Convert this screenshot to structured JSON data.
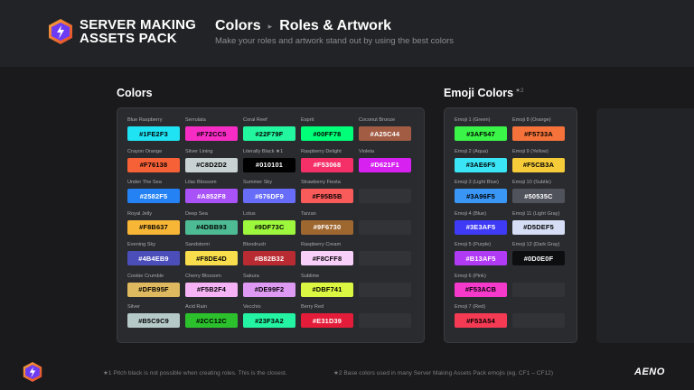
{
  "header": {
    "brand_line1": "SERVER MAKING",
    "brand_line2": "ASSETS PACK",
    "crumb_current_section": "Colors",
    "crumb_separator": "▸",
    "crumb_page": "Roles & Artwork",
    "subtitle": "Make your roles and artwork stand out by using the best colors"
  },
  "colors_section": {
    "title": "Colors",
    "swatches": [
      {
        "name": "Blue Raspberry",
        "hex": "#1FE2F3",
        "text": "#000"
      },
      {
        "name": "Serrulata",
        "hex": "#F72CC5",
        "text": "#000"
      },
      {
        "name": "Coral Reef",
        "hex": "#22F79F",
        "text": "#000"
      },
      {
        "name": "Esprit",
        "hex": "#00FF78",
        "text": "#000"
      },
      {
        "name": "Coconut Bronze",
        "hex": "#A25C44",
        "text": "#fff"
      },
      {
        "name": "Crayon Orange",
        "hex": "#F76138",
        "text": "#000"
      },
      {
        "name": "Silver Lining",
        "hex": "#C8D2D2",
        "text": "#000"
      },
      {
        "name": "Literally Black ★1",
        "hex": "#010101",
        "text": "#fff"
      },
      {
        "name": "Raspberry Delight",
        "hex": "#F53068",
        "text": "#fff"
      },
      {
        "name": "Violeta",
        "hex": "#D621F1",
        "text": "#fff"
      },
      {
        "name": "Under The Sea",
        "hex": "#2582F5",
        "text": "#fff"
      },
      {
        "name": "Lilac Blossom",
        "hex": "#A852F8",
        "text": "#fff"
      },
      {
        "name": "Summer Sky",
        "hex": "#676DF9",
        "text": "#fff"
      },
      {
        "name": "Strawberry Fiesta",
        "hex": "#F95B5B",
        "text": "#000"
      },
      null,
      {
        "name": "Royal Jelly",
        "hex": "#F8B637",
        "text": "#000"
      },
      {
        "name": "Deep Sea",
        "hex": "#4DBB93",
        "text": "#000"
      },
      {
        "name": "Lotus",
        "hex": "#9DF73C",
        "text": "#000"
      },
      {
        "name": "Tarzan",
        "hex": "#9F6730",
        "text": "#fff"
      },
      null,
      {
        "name": "Evening Sky",
        "hex": "#4B4EB9",
        "text": "#fff"
      },
      {
        "name": "Sandstorm",
        "hex": "#F8DE4D",
        "text": "#000"
      },
      {
        "name": "Bloodrush",
        "hex": "#B82B32",
        "text": "#fff"
      },
      {
        "name": "Raspberry Cream",
        "hex": "#F8CFF8",
        "text": "#000"
      },
      null,
      {
        "name": "Cookie Crumble",
        "hex": "#DFB95F",
        "text": "#000"
      },
      {
        "name": "Cherry Blossom",
        "hex": "#F5B2F4",
        "text": "#000"
      },
      {
        "name": "Sakura",
        "hex": "#DE99F2",
        "text": "#000"
      },
      {
        "name": "Sublime",
        "hex": "#DBF741",
        "text": "#000"
      },
      null,
      {
        "name": "Silver",
        "hex": "#B5C9C9",
        "text": "#000"
      },
      {
        "name": "Acid Rain",
        "hex": "#2CC12C",
        "text": "#000"
      },
      {
        "name": "Vecchio",
        "hex": "#23F3A2",
        "text": "#000"
      },
      {
        "name": "Berry Red",
        "hex": "#E31D39",
        "text": "#fff"
      },
      null
    ]
  },
  "emoji_section": {
    "title": "Emoji Colors",
    "title_note": "★2",
    "swatches": [
      {
        "name": "Emoji 1 (Green)",
        "hex": "#3AF547",
        "text": "#000"
      },
      {
        "name": "Emoji 8 (Orange)",
        "hex": "#F5733A",
        "text": "#000"
      },
      {
        "name": "Emoji 2 (Aqua)",
        "hex": "#3AE6F5",
        "text": "#000"
      },
      {
        "name": "Emoji 9 (Yellow)",
        "hex": "#F5CB3A",
        "text": "#000"
      },
      {
        "name": "Emoji 3 (Light Blue)",
        "hex": "#3A96F5",
        "text": "#000"
      },
      {
        "name": "Emoji 10 (Subtle)",
        "hex": "#50535C",
        "text": "#fff"
      },
      {
        "name": "Emoji 4 (Blue)",
        "hex": "#3E3AF5",
        "text": "#fff"
      },
      {
        "name": "Emoji 11 (Light Gray)",
        "hex": "#D5DEF5",
        "text": "#000"
      },
      {
        "name": "Emoji 5 (Purple)",
        "hex": "#B13AF5",
        "text": "#fff"
      },
      {
        "name": "Emoji 12 (Dark Gray)",
        "hex": "#0D0E0F",
        "text": "#fff"
      },
      {
        "name": "Emoji 6 (Pink)",
        "hex": "#F53ACB",
        "text": "#000"
      },
      null,
      {
        "name": "Emoji 7 (Red)",
        "hex": "#F53A54",
        "text": "#000"
      },
      null
    ]
  },
  "footer": {
    "note1": "★1  Pitch black is not possible when creating roles. This is the closest.",
    "note2": "★2  Base colors used in many Server Making Assets Pack emojis (eg. CF1 – CF12)",
    "credit": "AENO"
  },
  "accent_colors": {
    "background": "#1a1a1d",
    "panel": "#2a2b2f",
    "logo_orange": "#f5733a",
    "logo_purple": "#6c3cf5"
  }
}
